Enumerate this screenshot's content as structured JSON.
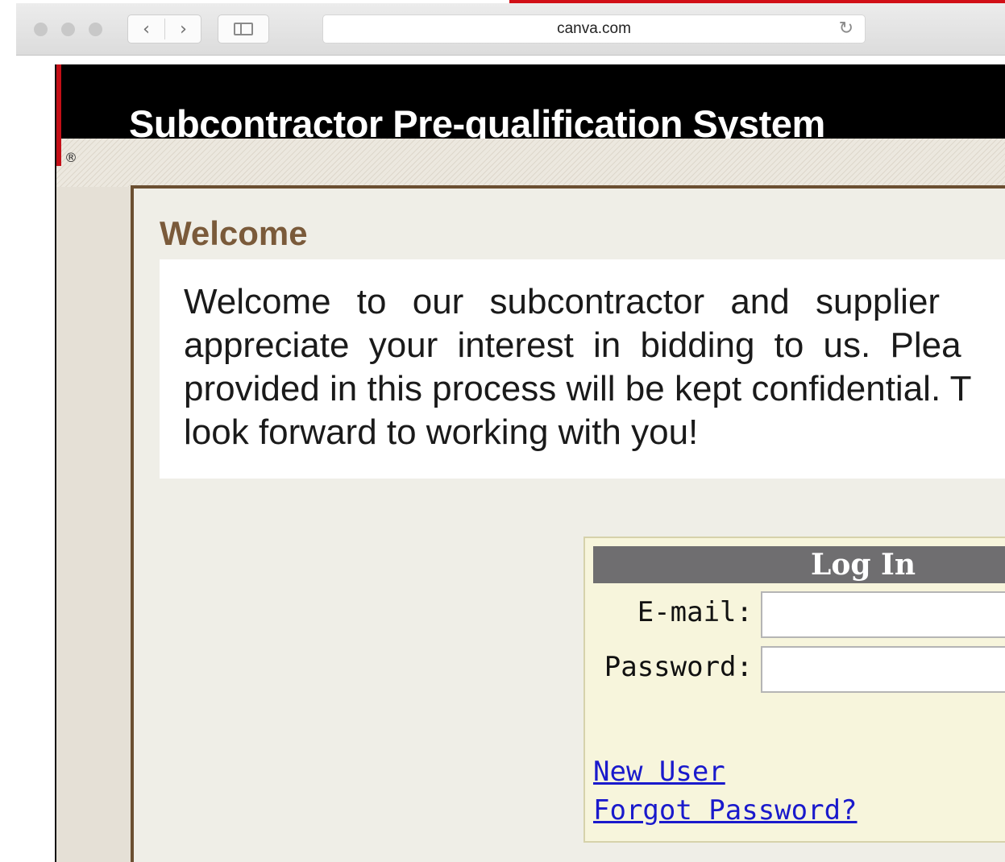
{
  "browser": {
    "url": "canva.com"
  },
  "site": {
    "title": "Subcontractor Pre-qualification System",
    "registered_mark": "®"
  },
  "welcome": {
    "heading": "Welcome",
    "lines": [
      "Welcome to our subcontractor and supplier",
      "appreciate your interest in bidding to us. Plea",
      "provided in this process will be kept confidential. T",
      "look forward to working with you!"
    ]
  },
  "login": {
    "header": "Log In",
    "email_label": "E-mail:",
    "email_value": "",
    "password_label": "Password:",
    "password_value": "",
    "new_user_link": "New User",
    "forgot_password_link": "Forgot Password?"
  },
  "icons": {
    "back": "chevron-left-icon",
    "forward": "chevron-right-icon",
    "sidebar": "sidebar-icon",
    "reload": "reload-icon"
  },
  "colors": {
    "accent_red": "#d10f16",
    "header_black": "#000000",
    "heading_brown": "#7a5a3a",
    "login_bg": "#f7f5dc",
    "login_header_gray": "#6f6e70",
    "link_blue": "#1a1acc"
  }
}
